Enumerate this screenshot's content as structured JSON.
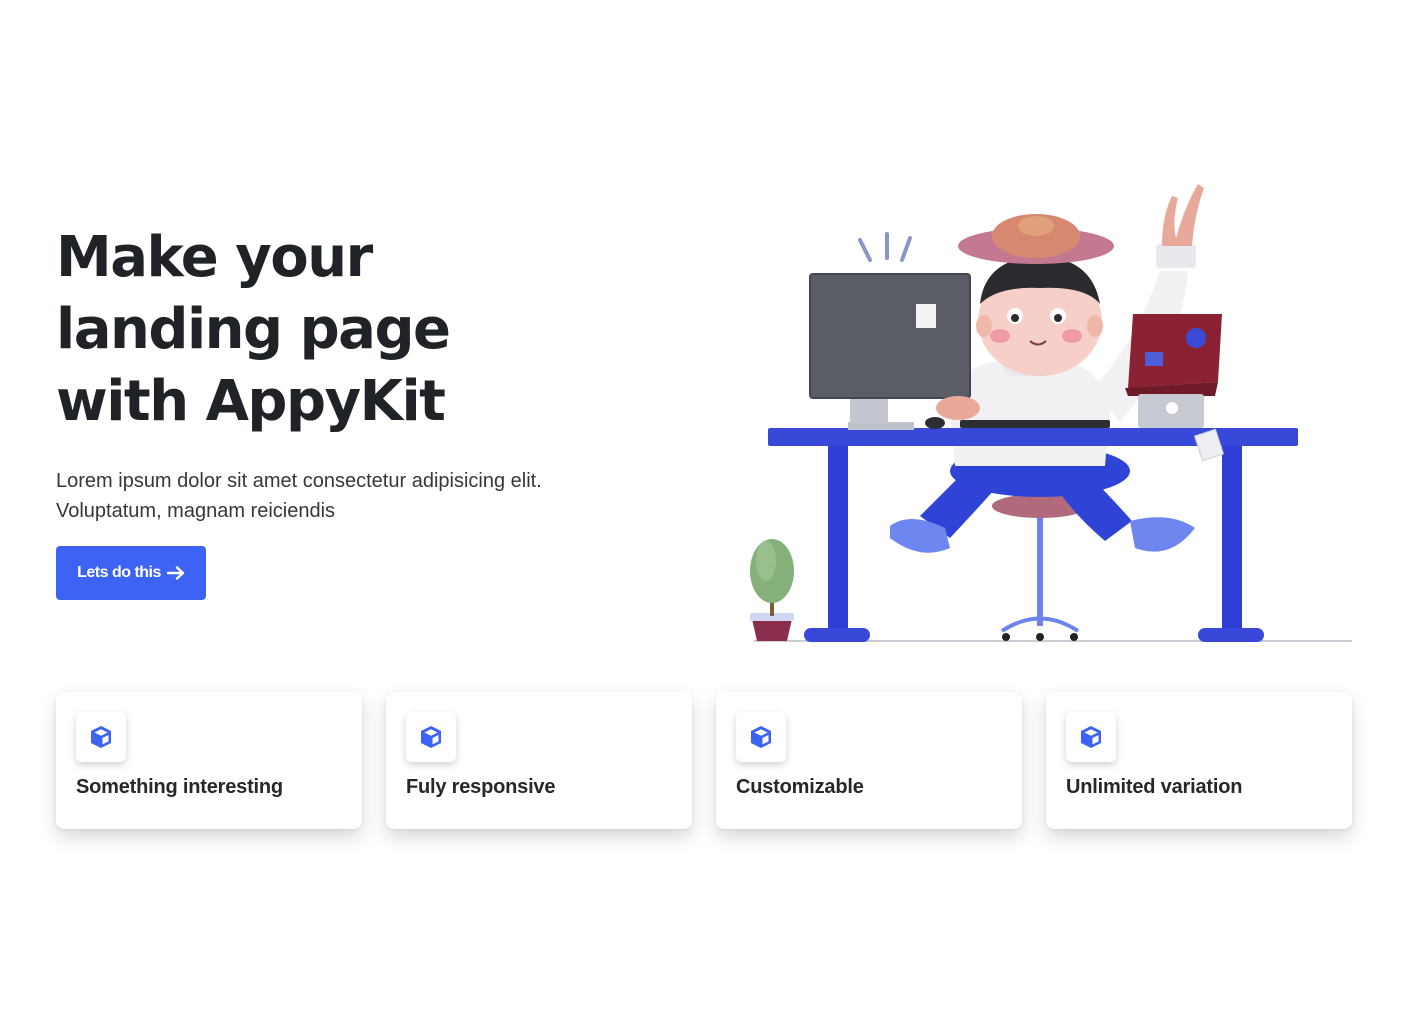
{
  "hero": {
    "title_lines": [
      "Make your",
      "landing page",
      "with AppyKit"
    ],
    "description_lines": [
      "Lorem ipsum dolor sit amet consectetur adipisicing elit.",
      "Voluptatum, magnam reiciendis"
    ],
    "cta_label": "Lets do this",
    "cta_icon": "arrow-right-icon",
    "accent_color": "#3d63f5"
  },
  "illustration": {
    "name": "person-at-desk-illustration",
    "desk_color": "#3444d8"
  },
  "features": [
    {
      "label": "Something interesting",
      "icon": "cube-icon"
    },
    {
      "label": "Fuly responsive",
      "icon": "cube-icon"
    },
    {
      "label": "Customizable",
      "icon": "cube-icon"
    },
    {
      "label": "Unlimited variation",
      "icon": "cube-icon"
    }
  ]
}
